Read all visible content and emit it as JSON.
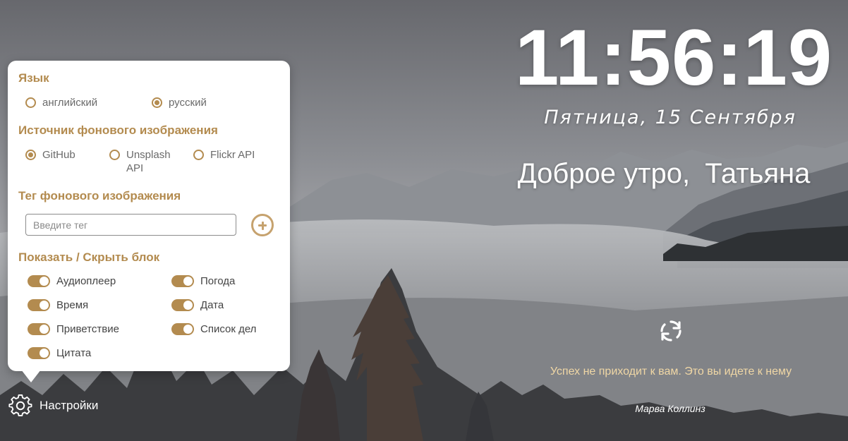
{
  "clock": {
    "time": "11:56:19"
  },
  "date": {
    "text": "Пятница, 15 Сентября"
  },
  "greeting": {
    "text": "Доброе утро,",
    "name": "Татьяна"
  },
  "quote": {
    "text": "Успех не приходит к вам. Это вы идете к нему",
    "author": "Марва Коллинз"
  },
  "settings": {
    "launcher_label": "Настройки",
    "language": {
      "title": "Язык",
      "options": [
        {
          "label": "английский",
          "checked": false
        },
        {
          "label": "русский",
          "checked": true
        }
      ]
    },
    "background_source": {
      "title": "Источник фонового изображения",
      "options": [
        {
          "label": "GitHub",
          "checked": true
        },
        {
          "label": "Unsplash API",
          "checked": false
        },
        {
          "label": "Flickr API",
          "checked": false
        }
      ]
    },
    "background_tag": {
      "title": "Тег фонового изображения",
      "placeholder": "Введите тег",
      "value": ""
    },
    "blocks": {
      "title": "Показать / Скрыть блок",
      "items": [
        {
          "label": "Аудиоплеер",
          "on": true
        },
        {
          "label": "Погода",
          "on": true
        },
        {
          "label": "Время",
          "on": true
        },
        {
          "label": "Дата",
          "on": true
        },
        {
          "label": "Приветствие",
          "on": true
        },
        {
          "label": "Список дел",
          "on": true
        },
        {
          "label": "Цитата",
          "on": true
        }
      ]
    }
  },
  "colors": {
    "accent": "#b38b4f",
    "quote_text": "#f0d7a5",
    "panel_bg": "#ffffff"
  },
  "icons": {
    "refresh": "refresh-icon",
    "settings": "gear-icon",
    "add": "plus-circle-icon"
  }
}
